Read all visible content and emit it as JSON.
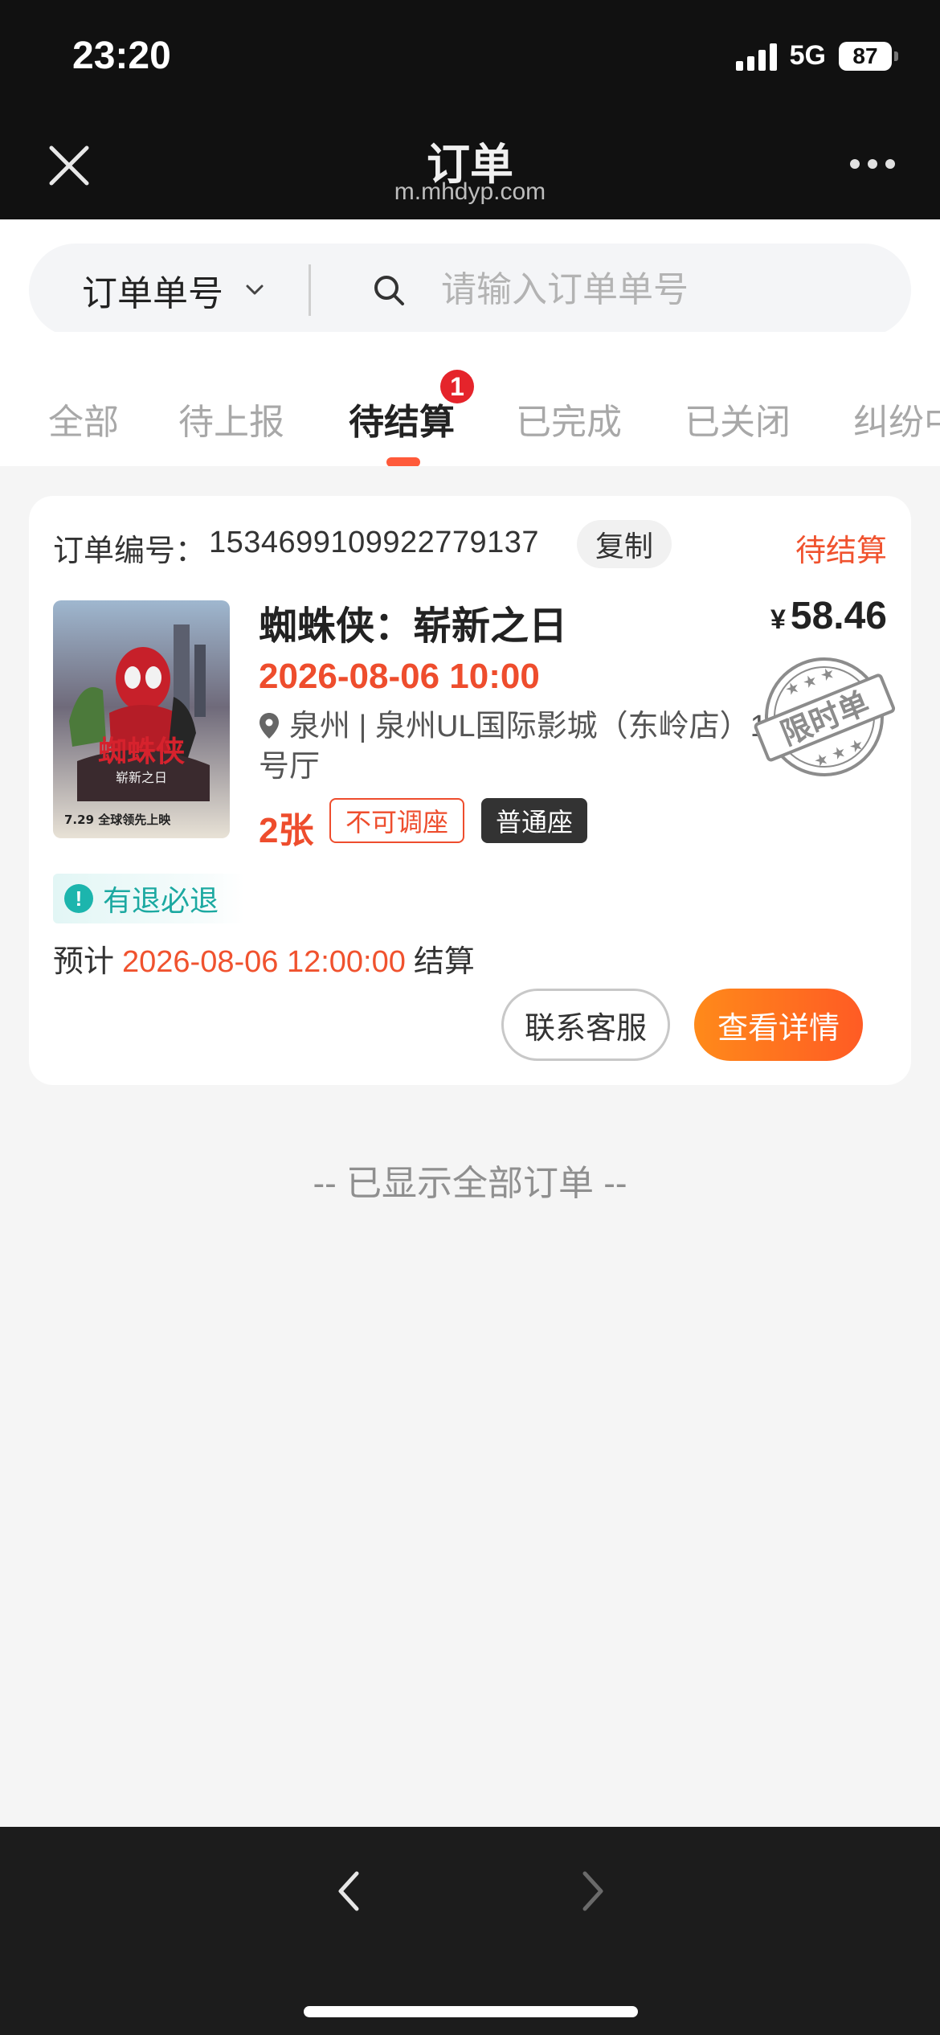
{
  "status_bar": {
    "time": "23:20",
    "network": "5G",
    "battery": "87"
  },
  "header": {
    "title": "订单",
    "subtitle": "m.mhdyp.com"
  },
  "search": {
    "type_label": "订单单号",
    "placeholder": "请输入订单单号"
  },
  "tabs": {
    "items": [
      {
        "label": "全部"
      },
      {
        "label": "待上报"
      },
      {
        "label": "待结算"
      },
      {
        "label": "已完成"
      },
      {
        "label": "已关闭"
      },
      {
        "label": "纠纷中"
      }
    ],
    "active_index": 2,
    "badge_count": "1"
  },
  "order": {
    "number_label": "订单编号：",
    "number": "1534699109922779137",
    "copy_label": "复制",
    "status": "待结算",
    "movie_title": "蜘蛛侠：崭新之日",
    "price_symbol": "¥",
    "price": "58.46",
    "showtime": "2026-08-06 10:00",
    "location": "泉州 | 泉州UL国际影城（东岭店）1号厅",
    "ticket_count": "2张",
    "tag_no_adjust": "不可调座",
    "tag_seat_type": "普通座",
    "stamp_text": "限时单",
    "refund_icon": "!",
    "refund_label": "有退必退",
    "settle_prefix": "预计",
    "settle_date": "2026-08-06 12:00:00",
    "settle_suffix": "结算",
    "contact_button": "联系客服",
    "detail_button": "查看详情",
    "poster": {
      "title": "蜘蛛侠",
      "subtitle": "崭新之日",
      "release": "7.29 全球领先上映"
    }
  },
  "list_end_text": "-- 已显示全部订单 --",
  "colors": {
    "accent": "#ee4d2d",
    "status": "#f0522e",
    "badge": "#e5242b",
    "teal": "#1cb5ad"
  }
}
